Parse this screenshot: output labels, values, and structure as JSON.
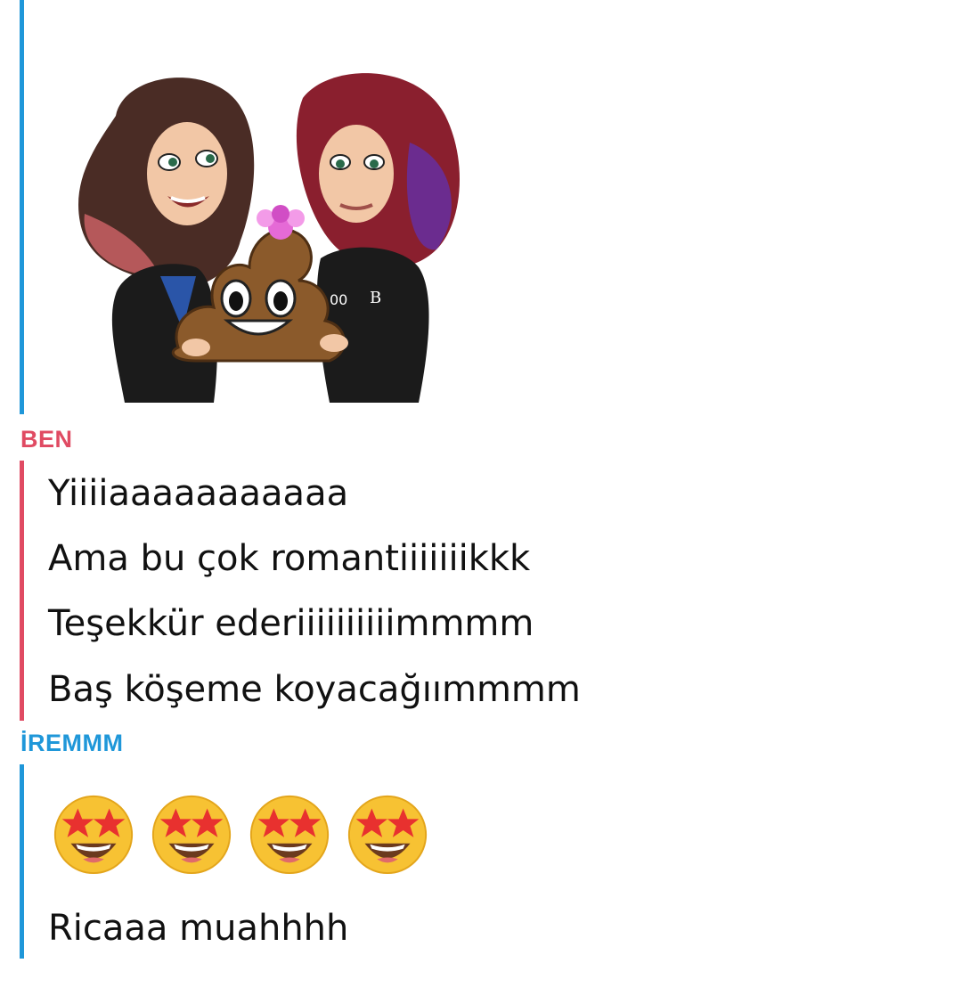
{
  "colors": {
    "friend": "#1f97d9",
    "me": "#e04b63",
    "text": "#111111"
  },
  "chat": {
    "sticker": {
      "icon": "bitmoji-sticker-two-girls-with-poop-emoji-gift"
    },
    "groups": [
      {
        "sender": "BEN",
        "color": "#e04b63",
        "messages": [
          "Yiiiiaaaaaaaaaaa",
          "Ama bu çok romantiiiiiiikkk",
          "Teşekkür ederiiiiiiiiiimmmm",
          "Baş köşeme koyacağıımmmm"
        ]
      },
      {
        "sender": "İREMMM",
        "color": "#1f97d9",
        "emoji_icon": "star-struck-emoji",
        "emoji_count": 4,
        "messages": [
          "Ricaaa muahhhh"
        ]
      }
    ]
  }
}
